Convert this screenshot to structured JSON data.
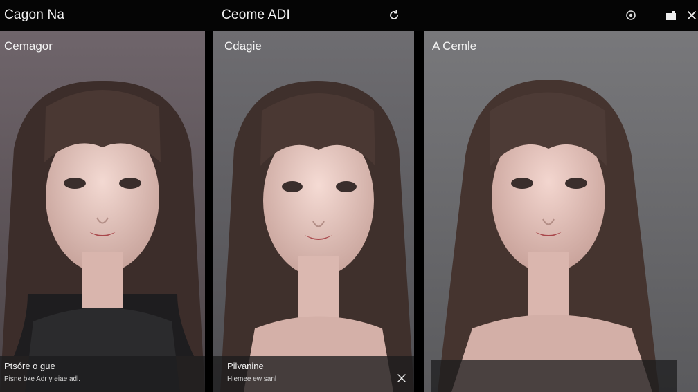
{
  "topbar": {
    "left_title": "Cagon Na",
    "center_title": "Ceome ADI",
    "icons": [
      "refresh-icon",
      "settings-icon",
      "folder-icon",
      "close-icon"
    ]
  },
  "panels": [
    {
      "label": "Cemagor",
      "caption_title": "Ptsóre o gue",
      "caption_sub": "Pisne bke Adr y eiae adl."
    },
    {
      "label": "Cdagie",
      "caption_title": "Pilvanine",
      "caption_sub": "Hiemee ew sanl"
    },
    {
      "label": "A Cemle"
    }
  ],
  "colors": {
    "topbar_bg": "#050505",
    "panel1_bg": "#6e6268",
    "panel2_bg": "#6b6a6e",
    "panel3_bg": "#737376",
    "hair": "#4a3a36"
  }
}
